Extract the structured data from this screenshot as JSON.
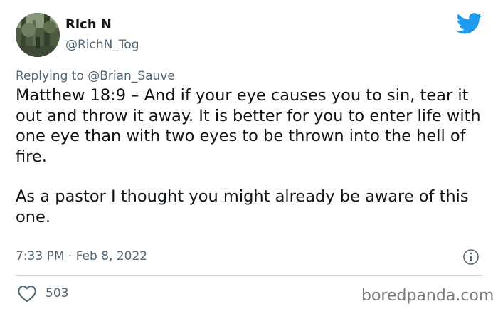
{
  "author": {
    "name": "Rich N",
    "handle": "@RichN_Tog",
    "avatar_icon": "forest-photo-avatar"
  },
  "platform_icon": "twitter-bird-icon",
  "brand_color": "#1d9bf0",
  "reply": {
    "prefix": "Replying to ",
    "mention": "@Brian_Sauve"
  },
  "tweet": {
    "paragraphs": [
      "Matthew 18:9 – And if your eye causes you to sin, tear it out and throw it away. It is better for you to enter life with one eye than with two eyes to be thrown into the hell of fire.",
      "As a pastor I thought you might already be aware of this one."
    ],
    "timestamp": "7:33 PM · Feb 8, 2022"
  },
  "actions": {
    "like_count": "503",
    "like_icon": "heart-icon",
    "info_icon": "info-icon"
  },
  "watermark": "boredpanda.com"
}
